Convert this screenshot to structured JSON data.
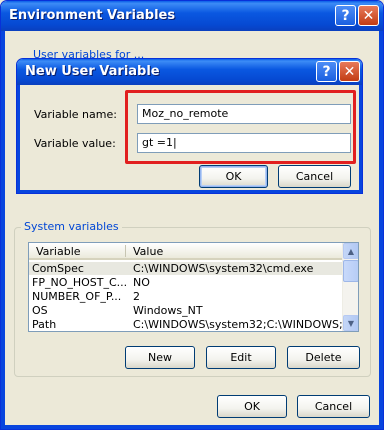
{
  "window": {
    "title": "Environment Variables",
    "help_glyph": "?",
    "close_glyph": "✕",
    "user_vars_label": "User variables for ..."
  },
  "dialog": {
    "title": "New User Variable",
    "help_glyph": "?",
    "close_glyph": "✕",
    "name_label": "Variable name:",
    "name_value": "Moz_no_remote",
    "value_label": "Variable value:",
    "value_value": "gt =1|",
    "ok_label": "OK",
    "cancel_label": "Cancel"
  },
  "system": {
    "group_title": "System variables",
    "columns": [
      "Variable",
      "Value"
    ],
    "rows": [
      {
        "variable": "ComSpec",
        "value": "C:\\WINDOWS\\system32\\cmd.exe"
      },
      {
        "variable": "FP_NO_HOST_C...",
        "value": "NO"
      },
      {
        "variable": "NUMBER_OF_P...",
        "value": "2"
      },
      {
        "variable": "OS",
        "value": "Windows_NT"
      },
      {
        "variable": "Path",
        "value": "C:\\WINDOWS\\system32;C:\\WINDOWS;..."
      }
    ],
    "new_label": "New",
    "edit_label": "Edit",
    "delete_label": "Delete"
  },
  "footer": {
    "ok_label": "OK",
    "cancel_label": "Cancel"
  },
  "colors": {
    "titlebar": "#0a58e1",
    "group_title": "#0046d5",
    "highlight": "#e11f1f"
  }
}
